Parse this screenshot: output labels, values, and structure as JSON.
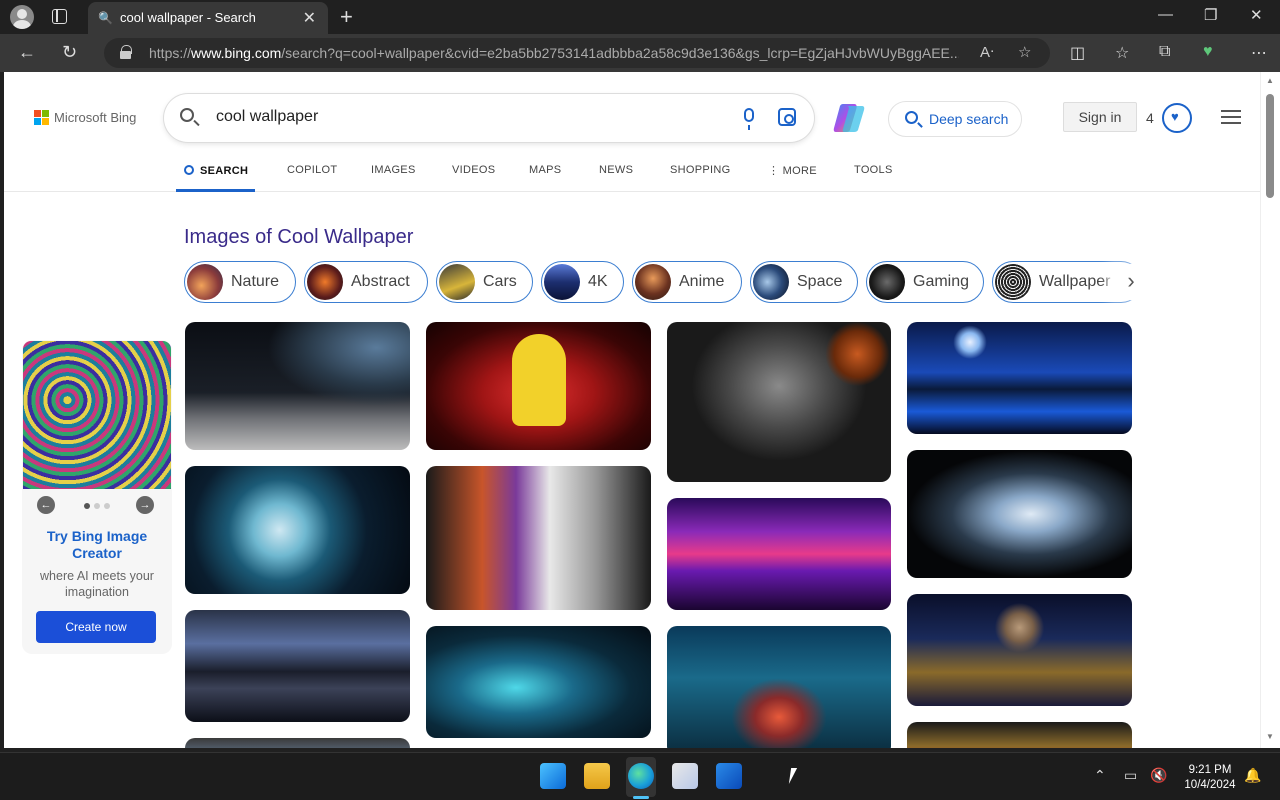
{
  "browser": {
    "tab_title": "cool wallpaper - Search",
    "url_prefix": "https://",
    "url_host": "www.bing.com",
    "url_rest": "/search?q=cool+wallpaper&cvid=e2ba5bb2753141adbbba2a58c9d3e136&gs_lcrp=EgZjaHJvbWUyBggAEE..."
  },
  "bing": {
    "logo_text": "Microsoft Bing",
    "query": "cool wallpaper",
    "deep_search": "Deep search",
    "sign_in": "Sign in",
    "points": "4",
    "nav_tabs": [
      "SEARCH",
      "COPILOT",
      "IMAGES",
      "VIDEOS",
      "MAPS",
      "NEWS",
      "SHOPPING",
      "MORE",
      "TOOLS"
    ],
    "images_heading": "Images of Cool Wallpaper",
    "chips": [
      "Nature",
      "Abstract",
      "Cars",
      "4K",
      "Anime",
      "Space",
      "Gaming",
      "Wallpaper"
    ],
    "promo": {
      "title": "Try Bing Image Creator",
      "subtitle": "where AI meets your imagination",
      "button": "Create now"
    }
  },
  "taskbar": {
    "time": "9:21 PM",
    "date": "10/4/2024"
  },
  "colors": {
    "accent": "#1b62c9",
    "heading": "#3a2b8a",
    "chip_border": "#3b7ed1"
  }
}
